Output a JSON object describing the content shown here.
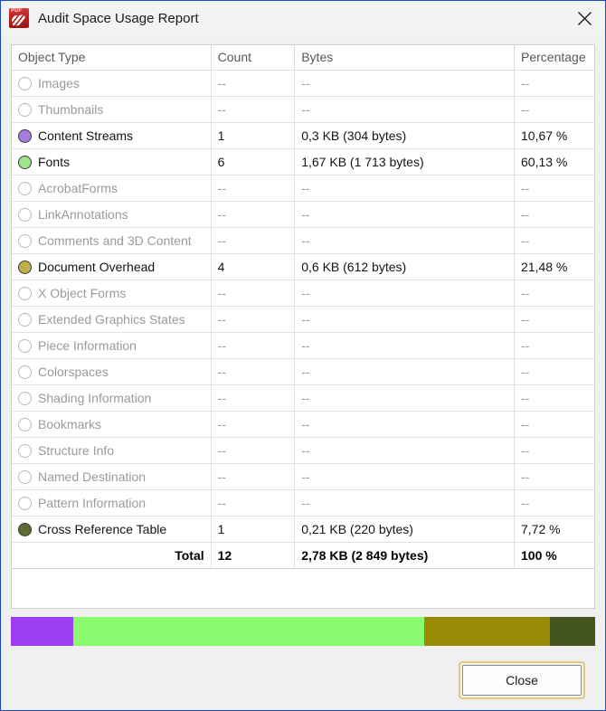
{
  "window": {
    "title": "Audit Space Usage Report",
    "app_icon": "pdf-document-icon",
    "close_icon": "close-icon"
  },
  "table": {
    "headers": [
      "Object Type",
      "Count",
      "Bytes",
      "Percentage"
    ],
    "empty_value": "--",
    "rows": [
      {
        "type": "Images",
        "count": "--",
        "bytes": "--",
        "percentage": "--",
        "color": null,
        "has_data": false
      },
      {
        "type": "Thumbnails",
        "count": "--",
        "bytes": "--",
        "percentage": "--",
        "color": null,
        "has_data": false
      },
      {
        "type": "Content Streams",
        "count": "1",
        "bytes": "0,3 KB (304 bytes)",
        "percentage": "10,67 %",
        "color": "#a97ae2",
        "has_data": true
      },
      {
        "type": "Fonts",
        "count": "6",
        "bytes": "1,67 KB (1 713 bytes)",
        "percentage": "60,13 %",
        "color": "#9de68b",
        "has_data": true
      },
      {
        "type": "AcrobatForms",
        "count": "--",
        "bytes": "--",
        "percentage": "--",
        "color": null,
        "has_data": false
      },
      {
        "type": "LinkAnnotations",
        "count": "--",
        "bytes": "--",
        "percentage": "--",
        "color": null,
        "has_data": false
      },
      {
        "type": "Comments and 3D Content",
        "count": "--",
        "bytes": "--",
        "percentage": "--",
        "color": null,
        "has_data": false
      },
      {
        "type": "Document Overhead",
        "count": "4",
        "bytes": "0,6 KB (612 bytes)",
        "percentage": "21,48 %",
        "color": "#bfae4a",
        "has_data": true
      },
      {
        "type": "X Object Forms",
        "count": "--",
        "bytes": "--",
        "percentage": "--",
        "color": null,
        "has_data": false
      },
      {
        "type": "Extended Graphics States",
        "count": "--",
        "bytes": "--",
        "percentage": "--",
        "color": null,
        "has_data": false
      },
      {
        "type": "Piece Information",
        "count": "--",
        "bytes": "--",
        "percentage": "--",
        "color": null,
        "has_data": false
      },
      {
        "type": "Colorspaces",
        "count": "--",
        "bytes": "--",
        "percentage": "--",
        "color": null,
        "has_data": false
      },
      {
        "type": "Shading Information",
        "count": "--",
        "bytes": "--",
        "percentage": "--",
        "color": null,
        "has_data": false
      },
      {
        "type": "Bookmarks",
        "count": "--",
        "bytes": "--",
        "percentage": "--",
        "color": null,
        "has_data": false
      },
      {
        "type": "Structure Info",
        "count": "--",
        "bytes": "--",
        "percentage": "--",
        "color": null,
        "has_data": false
      },
      {
        "type": "Named Destination",
        "count": "--",
        "bytes": "--",
        "percentage": "--",
        "color": null,
        "has_data": false
      },
      {
        "type": "Pattern Information",
        "count": "--",
        "bytes": "--",
        "percentage": "--",
        "color": null,
        "has_data": false
      },
      {
        "type": "Cross Reference Table",
        "count": "1",
        "bytes": "0,21 KB (220 bytes)",
        "percentage": "7,72 %",
        "color": "#5c6b31",
        "has_data": true
      }
    ],
    "total": {
      "label": "Total",
      "count": "12",
      "bytes": "2,78 KB (2 849 bytes)",
      "percentage": "100 %"
    }
  },
  "chart_data": {
    "type": "bar",
    "title": "Audit Space Usage Report",
    "orientation": "horizontal-stacked",
    "categories": [
      "Content Streams",
      "Fonts",
      "Document Overhead",
      "Cross Reference Table"
    ],
    "values": [
      10.67,
      60.13,
      21.48,
      7.72
    ],
    "value_unit": "%",
    "byte_values": [
      304,
      1713,
      612,
      220
    ],
    "count_values": [
      1,
      6,
      4,
      1
    ],
    "colors": [
      "#9a3ef0",
      "#8cfa6e",
      "#998a05",
      "#455520"
    ],
    "total_bytes": 2849,
    "total_count": 12,
    "total_percentage": 100,
    "xlabel": "",
    "ylabel": "",
    "xlim": [
      0,
      100
    ],
    "grid": false,
    "legend": "none"
  },
  "footer": {
    "close_label": "Close"
  }
}
